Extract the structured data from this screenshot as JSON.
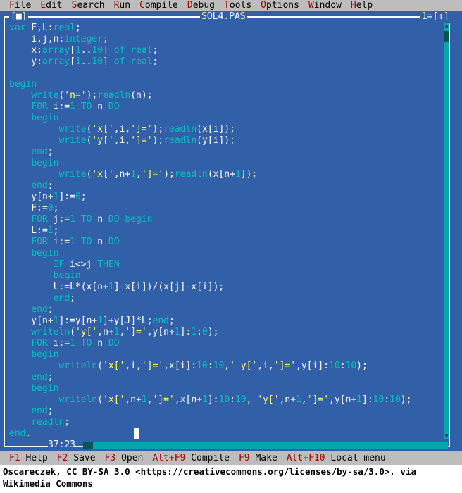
{
  "menu": [
    {
      "hot": "F",
      "rest": "ile"
    },
    {
      "hot": "E",
      "rest": "dit"
    },
    {
      "hot": "S",
      "rest": "earch"
    },
    {
      "hot": "R",
      "rest": "un"
    },
    {
      "hot": "C",
      "rest": "ompile"
    },
    {
      "hot": "D",
      "rest": "ebug"
    },
    {
      "hot": "T",
      "rest": "ools"
    },
    {
      "hot": "O",
      "rest": "ptions"
    },
    {
      "hot": "W",
      "rest": "indow"
    },
    {
      "hot": "H",
      "rest": "elp"
    }
  ],
  "window": {
    "close_box": "[■]",
    "title": "SOL4.PAS",
    "zoom_box": "1=[↕]",
    "cursor_pos": "37:23"
  },
  "code_lines": [
    "var F,L:real;",
    "    i,j,n:integer;",
    "    x:array[1..10] of real;",
    "    y:array[1..10] of real;",
    "",
    "begin",
    "    write('n=');readln(n);",
    "    FOR i:=1 TO n DO",
    "    begin",
    "         write('x[',i,']=');readln(x[i]);",
    "         write('y[',i,']=');readln(y[i]);",
    "    end;",
    "    begin",
    "         write('x[',n+1,']=');readln(x[n+1]);",
    "    end;",
    "    y[n+1]:=0;",
    "    F:=0;",
    "    FOR j:=1 TO n DO begin",
    "    L:=1;",
    "    FOR i:=1 TO n DO",
    "    begin",
    "        IF i<>j THEN",
    "        begin",
    "        L:=L*(x[n+1]-x[i])/(x[j]-x[i]);",
    "        end;",
    "    end;",
    "    y[n+1]:=y[n+1]+y[J]*L;end;",
    "    writeln('y[',n+1,']=',y[n+1]:1:0);",
    "    FOR i:=1 TO n DO",
    "    begin",
    "         writeln('x[',i,']=',x[i]:10:10,' y[',i,']=',y[i]:10:10);",
    "    end;",
    "    begin",
    "         writeln('x[',n+1,']=',x[n+1]:10:10, 'y[',n+1,']=',y[n+1]:10:10);",
    "    end;",
    "    readln;",
    "end."
  ],
  "fkeys": [
    {
      "key": "F1",
      "label": "Help"
    },
    {
      "key": "F2",
      "label": "Save"
    },
    {
      "key": "F3",
      "label": "Open"
    },
    {
      "key": "Alt+F9",
      "label": "Compile"
    },
    {
      "key": "F9",
      "label": "Make"
    },
    {
      "key": "Alt+F10",
      "label": "Local menu"
    }
  ],
  "credit": "Oscareczek, CC BY-SA 3.0 <https://creativecommons.org/licenses/by-sa/3.0>, via Wikimedia Commons",
  "colors": {
    "editor_bg": "#3260a8",
    "keyword": "#00c0c0",
    "string": "#ffff54",
    "menu_bg": "#bdbdbd",
    "hotkey": "#a80000"
  }
}
